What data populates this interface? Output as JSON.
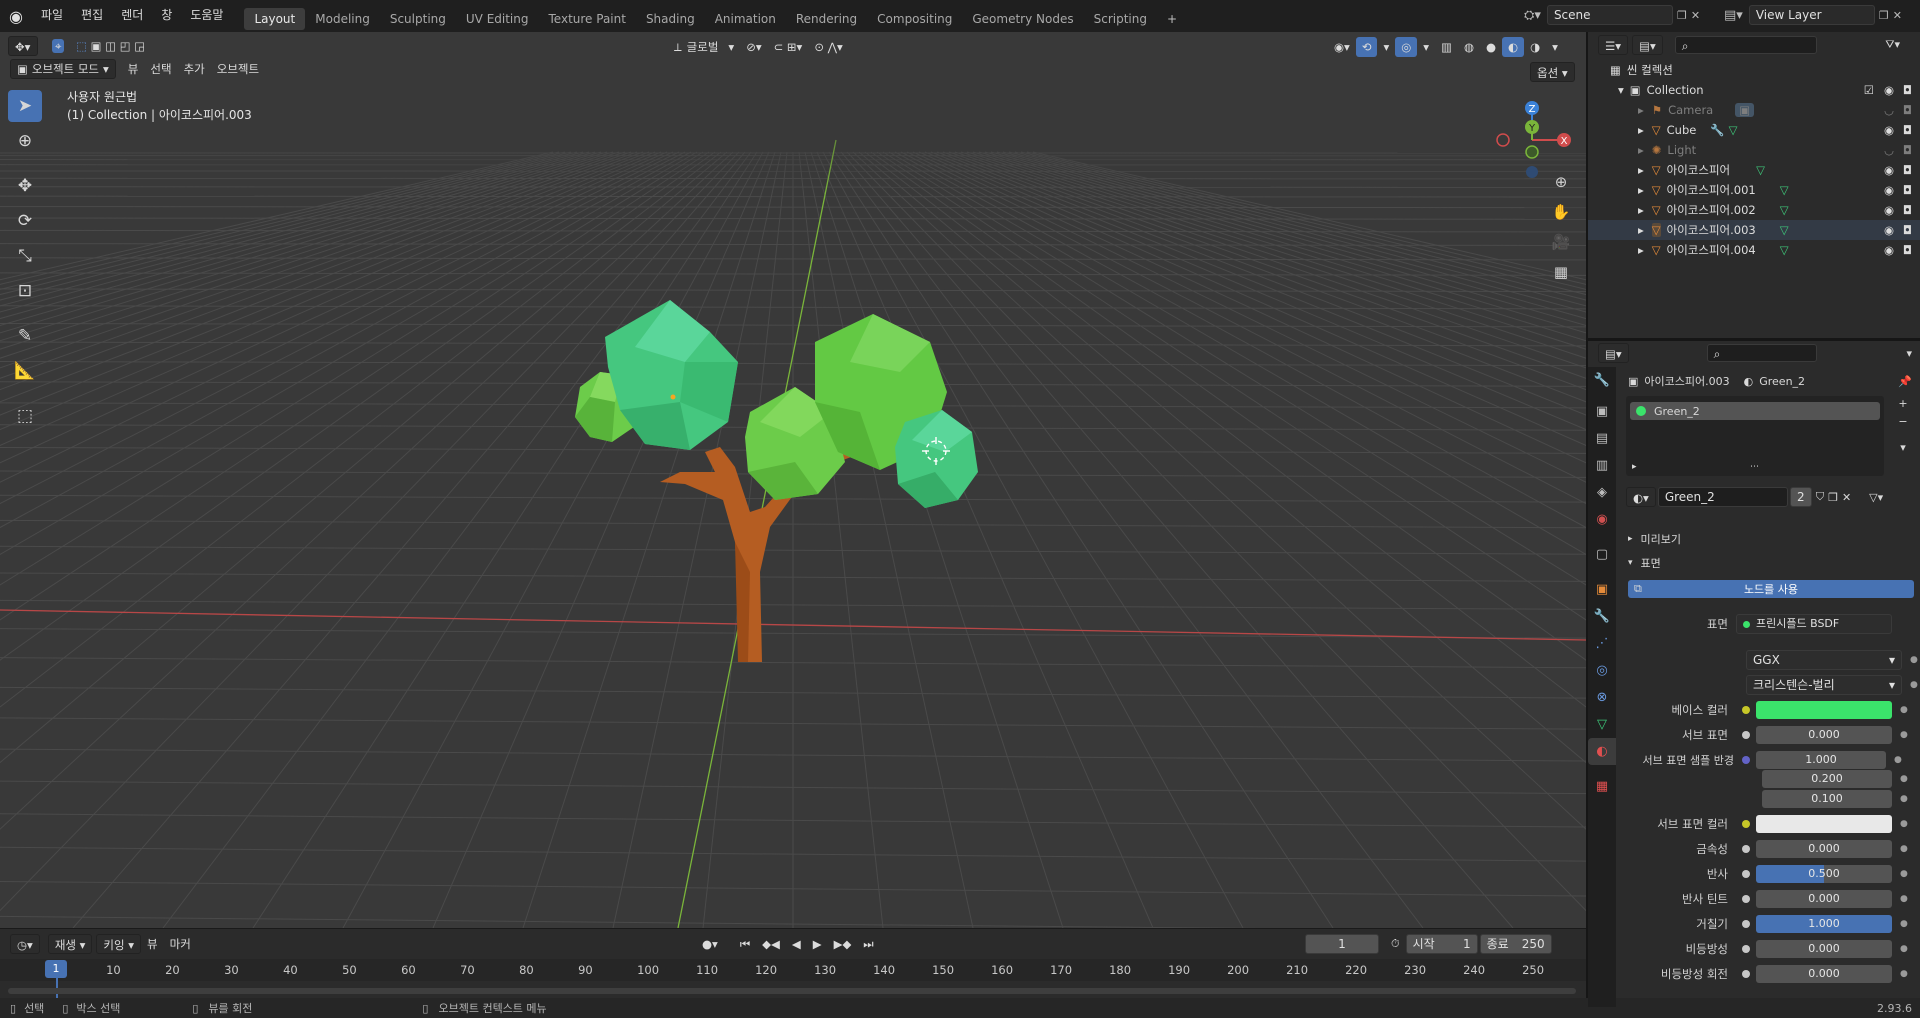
{
  "topbar": {
    "menus": [
      "파일",
      "편집",
      "렌더",
      "창",
      "도움말"
    ],
    "workspaces": [
      "Layout",
      "Modeling",
      "Sculpting",
      "UV Editing",
      "Texture Paint",
      "Shading",
      "Animation",
      "Rendering",
      "Compositing",
      "Geometry Nodes",
      "Scripting"
    ],
    "active_workspace": "Layout",
    "add_tab": "+",
    "scene": "Scene",
    "view_layer": "View Layer"
  },
  "viewport": {
    "mode": "오브젝트 모드",
    "menus": [
      "뷰",
      "선택",
      "추가",
      "오브젝트"
    ],
    "transform_orientation": "글로벌",
    "options": "옵션",
    "view_name": "사용자 원근법",
    "object_info": "(1) Collection | 아이코스피어.003",
    "gizmo_axes": {
      "x": "X",
      "y": "Y",
      "z": "Z"
    },
    "colors": {
      "bg": "#393939",
      "leaf_light": "#4fd08a",
      "leaf_green": "#6ccc4a",
      "trunk": "#b55d22",
      "x_axis": "#c44848",
      "y_axis": "#7ab53a",
      "accent": "#4772b3"
    }
  },
  "timeline": {
    "menus": [
      "재생",
      "키잉",
      "뷰",
      "마커"
    ],
    "current_frame": "1",
    "start_label": "시작",
    "start": "1",
    "end_label": "종료",
    "end": "250",
    "ticks": [
      "1",
      "10",
      "20",
      "30",
      "40",
      "50",
      "60",
      "70",
      "80",
      "90",
      "100",
      "110",
      "120",
      "130",
      "140",
      "150",
      "160",
      "170",
      "180",
      "190",
      "200",
      "210",
      "220",
      "230",
      "240",
      "250"
    ]
  },
  "statusbar": {
    "items": [
      "선택",
      "박스 선택",
      "뷰를 회전",
      "오브젝트 컨텍스트 메뉴"
    ],
    "version": "2.93.6"
  },
  "outliner": {
    "scene_collection": "씬 컬렉션",
    "collection": "Collection",
    "items": [
      {
        "name": "Camera",
        "dim": true
      },
      {
        "name": "Cube",
        "dim": false
      },
      {
        "name": "Light",
        "dim": true
      },
      {
        "name": "아이코스피어",
        "dim": false
      },
      {
        "name": "아이코스피어.001",
        "dim": false
      },
      {
        "name": "아이코스피어.002",
        "dim": false
      },
      {
        "name": "아이코스피어.003",
        "dim": false
      },
      {
        "name": "아이코스피어.004",
        "dim": false
      }
    ]
  },
  "properties": {
    "object": "아이코스피어.003",
    "material": "Green_2",
    "slot": "Green_2",
    "material_field": "Green_2",
    "users": "2",
    "preview_panel": "미리보기",
    "surface_panel": "표면",
    "use_nodes": "노드를 사용",
    "surface_label": "표면",
    "surface_value": "프린시플드 BSDF",
    "distribution": "GGX",
    "subsurface_method": "크리스텐슨-벌리",
    "rows": {
      "base_color": "베이스 컬러",
      "subsurface": "서브 표면",
      "subsurface_value": "0.000",
      "subsurface_radius": "서브 표면 샘플 반경",
      "radius_1": "1.000",
      "radius_2": "0.200",
      "radius_3": "0.100",
      "subsurface_color": "서브 표면 컬러",
      "metallic": "금속성",
      "metallic_value": "0.000",
      "specular": "반사",
      "specular_value": "0.500",
      "specular_tint": "반사 틴트",
      "specular_tint_value": "0.000",
      "roughness": "거칠기",
      "roughness_value": "1.000",
      "anisotropic": "비등방성",
      "anisotropic_value": "0.000",
      "anisotropic_rotation": "비등방성 회전",
      "anisotropic_rotation_value": "0.000"
    },
    "base_color_hex": "#3be36b",
    "subsurface_color_hex": "#e8e8e8"
  }
}
